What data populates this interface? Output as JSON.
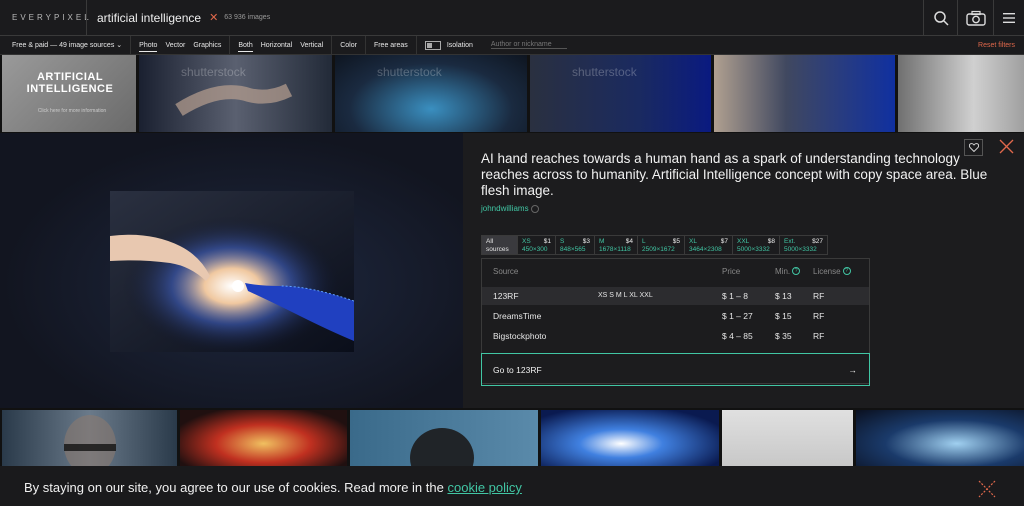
{
  "header": {
    "logo": "EVERYPIXEL",
    "query": "artificial intelligence",
    "result_count": "63 936 images"
  },
  "filters": {
    "sources": "Free & paid — 49 image sources",
    "types": [
      "Photo",
      "Vector",
      "Graphics"
    ],
    "orientation": [
      "Both",
      "Horizontal",
      "Vertical"
    ],
    "color": "Color",
    "free_areas": "Free areas",
    "isolation": "Isolation",
    "author_placeholder": "Author or nickname",
    "reset": "Reset filters"
  },
  "thumbnails_top": {
    "featured_title": "ARTIFICIAL INTELLIGENCE",
    "featured_subtitle": "Click here for more information",
    "watermark": "shutterstock"
  },
  "detail": {
    "title": "AI hand reaches towards a human hand as a spark of understanding technology reaches across to humanity. Artificial Intelligence concept with copy space area. Blue flesh image.",
    "author": "johndwilliams",
    "sizes": [
      {
        "label": "All",
        "sub": "sources"
      },
      {
        "label": "XS",
        "price": "$1",
        "dims": "450×300"
      },
      {
        "label": "S",
        "price": "$3",
        "dims": "848×565"
      },
      {
        "label": "M",
        "price": "$4",
        "dims": "1678×1118"
      },
      {
        "label": "L",
        "price": "$5",
        "dims": "2509×1672"
      },
      {
        "label": "XL",
        "price": "$7",
        "dims": "3464×2308"
      },
      {
        "label": "XXL",
        "price": "$8",
        "dims": "5000×3332"
      },
      {
        "label": "Ext.",
        "price": "$27",
        "dims": "5000×3332"
      }
    ],
    "table_headers": {
      "source": "Source",
      "price": "Price",
      "min": "Min.",
      "license": "License"
    },
    "rows": [
      {
        "source": "123RF",
        "sizes": "XS  S  M  L  XL  XXL",
        "price": "$ 1 – 8",
        "min": "$ 13",
        "license": "RF"
      },
      {
        "source": "DreamsTime",
        "sizes": "",
        "price": "$ 1 – 27",
        "min": "$ 15",
        "license": "RF"
      },
      {
        "source": "Bigstockphoto",
        "sizes": "",
        "price": "$ 4 – 85",
        "min": "$ 35",
        "license": "RF"
      }
    ],
    "goto": "Go to 123RF"
  },
  "cookie": {
    "text": "By staying on our site, you agree to our use of cookies. Read more in the",
    "link": "cookie policy"
  },
  "colors": {
    "accent": "#41c6a4",
    "warn": "#e0684b",
    "bg": "#1b1b1d"
  }
}
